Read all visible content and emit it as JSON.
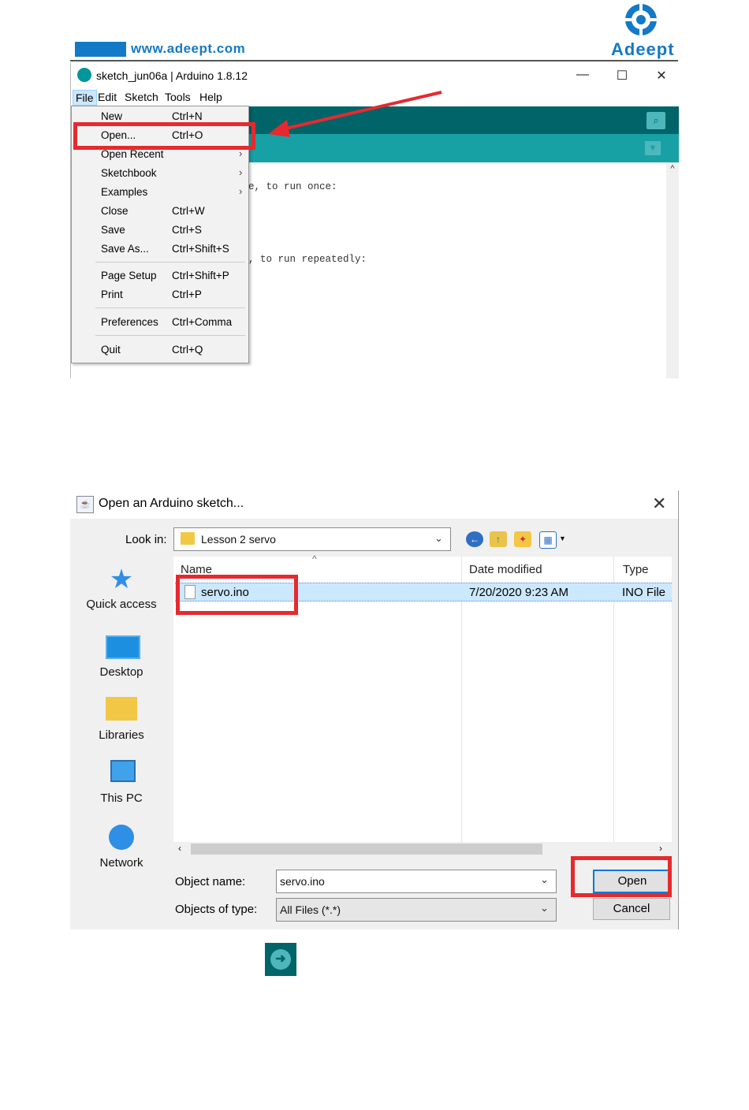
{
  "header": {
    "url": "www.adeept.com",
    "brand": "Adeept",
    "brand_icon": "adeept-gear-logo"
  },
  "arduino_window": {
    "title": "sketch_jun06a | Arduino 1.8.12",
    "window_controls": {
      "minimize": "—",
      "maximize": "☐",
      "close": "✕"
    },
    "menu": [
      "File",
      "Edit",
      "Sketch",
      "Tools",
      "Help"
    ],
    "code_lines": [
      "e, to run once:",
      ", to run repeatedly:"
    ],
    "file_menu": [
      {
        "label": "New",
        "shortcut": "Ctrl+N"
      },
      {
        "label": "Open...",
        "shortcut": "Ctrl+O"
      },
      {
        "label": "Open Recent",
        "shortcut": ""
      },
      {
        "label": "Sketchbook",
        "shortcut": ""
      },
      {
        "label": "Examples",
        "shortcut": ""
      },
      {
        "label": "Close",
        "shortcut": "Ctrl+W"
      },
      {
        "label": "Save",
        "shortcut": "Ctrl+S"
      },
      {
        "label": "Save As...",
        "shortcut": "Ctrl+Shift+S"
      },
      {
        "label": "Page Setup",
        "shortcut": "Ctrl+Shift+P"
      },
      {
        "label": "Print",
        "shortcut": "Ctrl+P"
      },
      {
        "label": "Preferences",
        "shortcut": "Ctrl+Comma"
      },
      {
        "label": "Quit",
        "shortcut": "Ctrl+Q"
      }
    ],
    "submenu_arrow": "›",
    "highlight_color": "#e52a2f",
    "toolbar_color": "#006468",
    "tab_color": "#17a1a5"
  },
  "open_dialog": {
    "title": "Open an Arduino sketch...",
    "close": "✕",
    "look_in_label": "Look in:",
    "look_in_value": "Lesson 2 servo",
    "places": [
      "Quick access",
      "Desktop",
      "Libraries",
      "This PC",
      "Network"
    ],
    "columns": [
      "Name",
      "Date modified",
      "Type"
    ],
    "files": [
      {
        "name": "servo.ino",
        "date": "7/20/2020 9:23 AM",
        "type": "INO File"
      }
    ],
    "object_name_label": "Object name:",
    "object_name_value": "servo.ino",
    "objects_type_label": "Objects of type:",
    "objects_type_value": "All Files (*.*)",
    "open_button": "Open",
    "cancel_button": "Cancel"
  },
  "run_icon": "arrow-right-icon"
}
